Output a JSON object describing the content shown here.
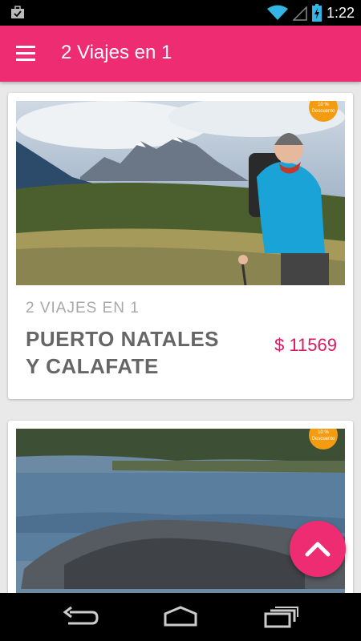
{
  "status_bar": {
    "time": "1:22",
    "icons": [
      "briefcase-icon",
      "wifi-icon",
      "signal-icon",
      "battery-charging-icon"
    ]
  },
  "app_bar": {
    "title": "2 Viajes en 1",
    "menu_icon": "hamburger-menu-icon",
    "color": "#ee2c72"
  },
  "cards": [
    {
      "category": "2 VIAJES EN 1",
      "title": "PUERTO NATALES Y CALAFATE",
      "price": "$ 11569",
      "badge": {
        "line1": "10 %",
        "line2": "Descuento"
      }
    },
    {
      "category": "",
      "title": "",
      "price": "",
      "badge": {
        "line1": "10 %",
        "line2": "Descuento"
      }
    }
  ],
  "fab": {
    "icon": "chevron-up-icon"
  },
  "nav_bar": {
    "icons": [
      "back-icon",
      "home-icon",
      "recent-apps-icon"
    ]
  },
  "colors": {
    "accent": "#ee2c72",
    "price": "#d81b60"
  }
}
